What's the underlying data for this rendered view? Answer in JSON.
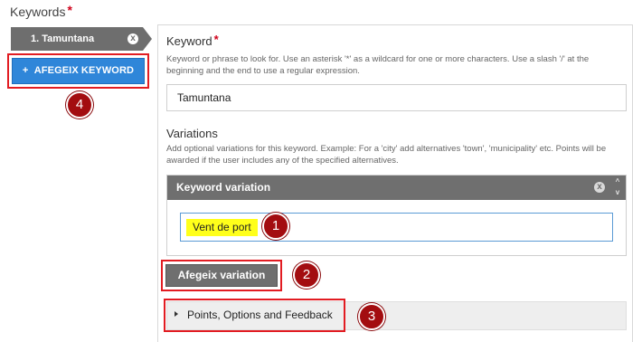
{
  "section": {
    "title": "Keywords",
    "required_mark": "*"
  },
  "keywords_list": [
    {
      "label": "1. Tamuntana",
      "close": "x"
    }
  ],
  "add_keyword_button": {
    "icon": "+",
    "label": "AFEGEIX KEYWORD",
    "color": "#2f86d9"
  },
  "keyword_field": {
    "label": "Keyword",
    "required_mark": "*",
    "help": "Keyword or phrase to look for. Use an asterisk '*' as a wildcard for one or more characters. Use a slash '/' at the beginning and the end to use a regular expression.",
    "value": "Tamuntana"
  },
  "variations": {
    "label": "Variations",
    "help": "Add optional variations for this keyword. Example: For a 'city' add alternatives 'town', 'municipality' etc. Points will be awarded if the user includes any of the specified alternatives.",
    "header": "Keyword variation",
    "close": "x",
    "up": "^",
    "down": "v",
    "value": "Vent de port"
  },
  "add_variation_button": {
    "label": "Afegeix variation"
  },
  "options_section": {
    "label": "Points, Options and Feedback"
  },
  "annotations": [
    "1",
    "2",
    "3",
    "4"
  ],
  "colors": {
    "highlight": "#ffff1a",
    "annotation_border": "#e21c22",
    "badge": "#a30d10"
  }
}
